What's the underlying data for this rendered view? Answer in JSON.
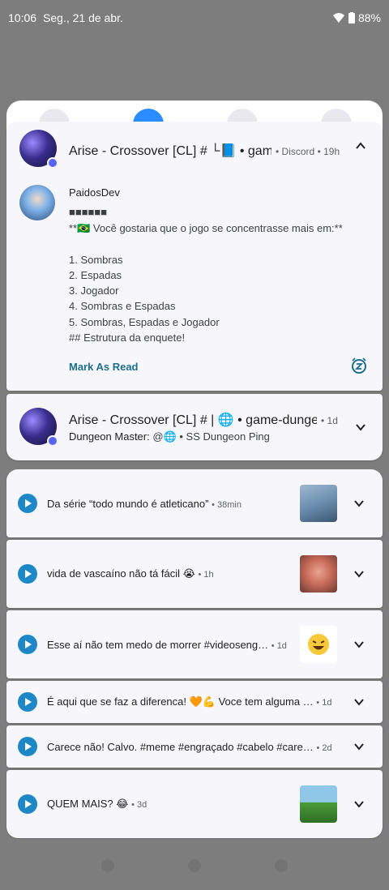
{
  "status_bar": {
    "time": "10:06",
    "date": "Seg., 21 de abr.",
    "battery": "88%"
  },
  "discord_expanded": {
    "title": "Arise - Crossover [CL] # └📘 • gam…",
    "app": "Discord",
    "age": "19h",
    "sender": "PaidosDev",
    "lines": [
      "■■■■■■",
      "**🇧🇷 Você gostaria que o jogo se concentrasse mais em:**",
      "",
      "1. Sombras",
      "2. Espadas",
      "3. Jogador",
      "4. Sombras e Espadas",
      "5. Sombras, Espadas e Jogador",
      "## Estrutura da enquete!"
    ],
    "action_label": "Mark As Read"
  },
  "discord_collapsed": {
    "title": "Arise - Crossover [CL] # | 🌐 • game-dunge…",
    "age": "1d",
    "sender": "Dungeon Master:",
    "message": "@🌐 • SS Dungeon Ping"
  },
  "youtube_notifications": [
    {
      "text": "Da série “todo mundo é atleticano”",
      "age": "38min",
      "thumb_color": "#6b8fb0"
    },
    {
      "text": "vida de vascaíno não tá fácil 😭",
      "age": "1h",
      "thumb_color": "#c96b5a"
    },
    {
      "text": "Esse aí não tem medo de morrer #videoseng…",
      "age": "1d",
      "thumb_color": "#f6c93b"
    },
    {
      "text": "É aqui que se faz a diferenca! 🧡💪 Voce tem alguma …",
      "age": "1d",
      "thumb_color": ""
    },
    {
      "text": "Carece não! Calvo. #meme #engraçado #cabelo #care…",
      "age": "2d",
      "thumb_color": ""
    },
    {
      "text": "QUEM MAIS? 😂",
      "age": "3d",
      "thumb_color": "#4a9c3a"
    }
  ],
  "colors": {
    "accent_blue": "#1e88c7",
    "action_teal": "#1c6e8f",
    "discord_badge": "#5865f2"
  }
}
